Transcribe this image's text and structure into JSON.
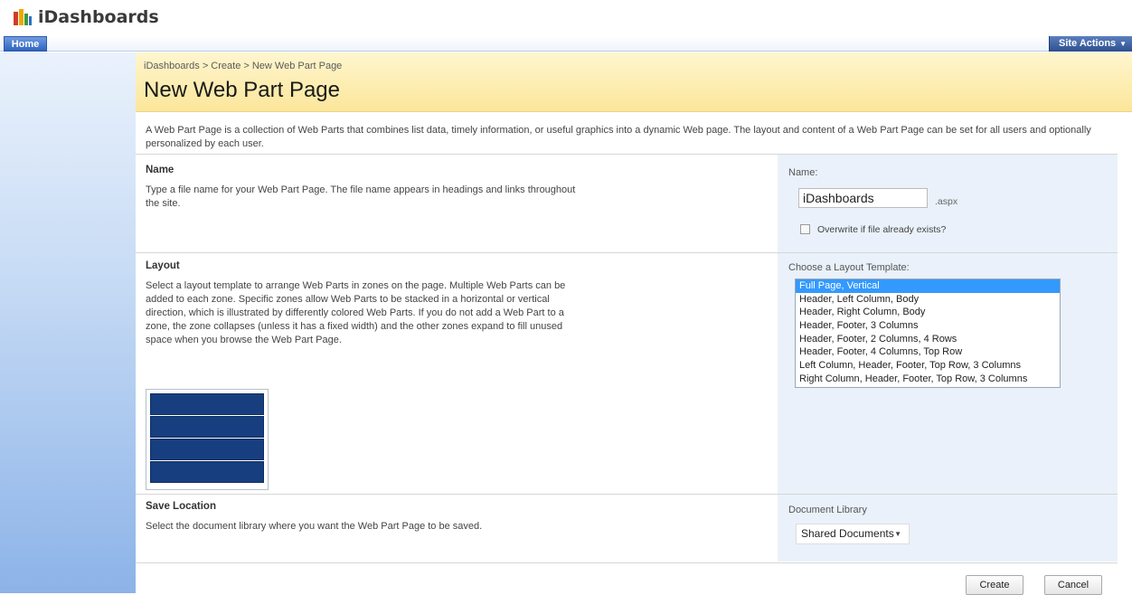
{
  "app": {
    "title": "iDashboards"
  },
  "nav": {
    "home_tab": "Home",
    "site_actions": "Site Actions"
  },
  "header": {
    "breadcrumb": "iDashboards > Create > New Web Part Page",
    "title": "New Web Part Page"
  },
  "intro": "A Web Part Page is a collection of Web Parts that combines list data, timely information, or useful graphics into a dynamic Web page. The layout and content of a Web Part Page can be set for all users and optionally personalized by each user.",
  "name_section": {
    "heading": "Name",
    "description": "Type a file name for your Web Part Page.  The file name appears in headings and links throughout the site.",
    "field_label": "Name:",
    "value": "iDashboards",
    "extension": ".aspx",
    "overwrite_label": "Overwrite if file already exists?",
    "overwrite_checked": false
  },
  "layout_section": {
    "heading": "Layout",
    "description": "Select a layout template to arrange Web Parts in zones on the page. Multiple Web Parts can be added to each zone. Specific zones allow Web Parts to be stacked in a horizontal or vertical direction, which is illustrated by differently colored Web Parts. If you do not add a Web Part to a zone, the zone collapses (unless it has a fixed width) and the other zones expand to fill unused space when you browse the Web Part Page.",
    "field_label": "Choose a Layout Template:",
    "options": [
      "Full Page, Vertical",
      "Header, Left Column, Body",
      "Header, Right Column, Body",
      "Header, Footer, 3 Columns",
      "Header, Footer, 2 Columns, 4 Rows",
      "Header, Footer, 4 Columns, Top Row",
      "Left Column, Header, Footer, Top Row, 3 Columns",
      "Right Column, Header, Footer, Top Row, 3 Columns"
    ],
    "selected": "Full Page, Vertical",
    "preview_zone_color": "#173f80"
  },
  "save_section": {
    "heading": "Save Location",
    "description": "Select the document library where you want the Web Part Page to be saved.",
    "field_label": "Document Library",
    "selected_library": "Shared Documents"
  },
  "actions": {
    "create": "Create",
    "cancel": "Cancel"
  },
  "colors": {
    "selected_option": "#3399ff",
    "title_band": "#fbe69a",
    "left_nav": "#8cb3e8"
  }
}
